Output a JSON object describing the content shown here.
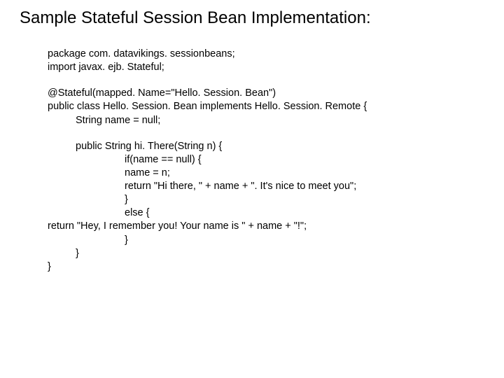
{
  "title": "Sample Stateful Session Bean Implementation:",
  "lines": {
    "l1": "package com. datavikings. sessionbeans;",
    "l2": "import javax. ejb. Stateful;",
    "l3": "@Stateful(mapped. Name=\"Hello. Session. Bean\")",
    "l4": "public class Hello. Session. Bean implements Hello. Session. Remote {",
    "l5": "String name = null;",
    "l6": "public String hi. There(String n) {",
    "l7": "if(name == null) {",
    "l8": "name = n;",
    "l9": "return \"Hi there, \" + name + \".  It's nice to meet you\";",
    "l10": "}",
    "l11": "else {",
    "l12": "return \"Hey, I remember you!  Your name is \" + name + \"!\";",
    "l13": "}",
    "l14": "}",
    "l15": "}"
  }
}
